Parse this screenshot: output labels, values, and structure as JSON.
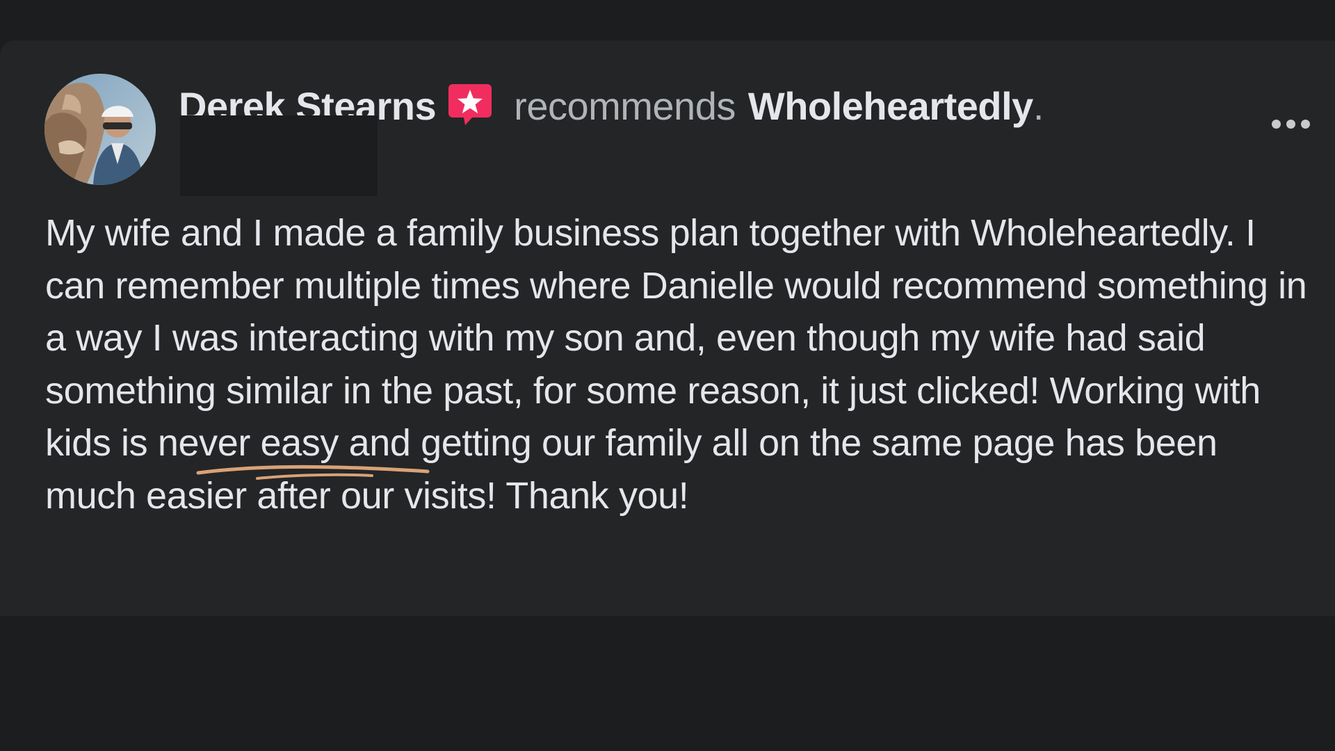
{
  "post": {
    "author": "Derek Stearns",
    "verb": "recommends",
    "page_name": "Wholeheartedly",
    "period": ".",
    "body": "My wife and I made a family business plan together with Wholeheartedly. I can remember multiple times where Danielle would recommend something in a way I was interacting with my son and, even though my wife had said something similar in the past, for some reason, it just clicked! Working with kids is never easy and getting our family all on the same page has been much easier after our visits! Thank you!"
  },
  "icons": {
    "badge": "recommendation-star-icon",
    "more": "more-options-icon"
  },
  "colors": {
    "background": "#1c1d1f",
    "card": "#242527",
    "primary_text": "#e4e6eb",
    "secondary_text": "#b0b3b8",
    "badge": "#f02d5e",
    "highlight_underline": "#d9a276"
  }
}
